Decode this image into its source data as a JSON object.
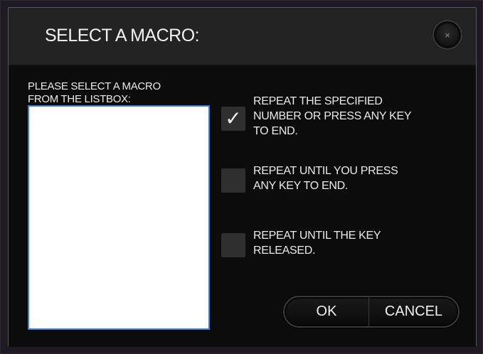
{
  "dialog": {
    "title": "SELECT A MACRO:",
    "close_symbol": "×"
  },
  "prompt": {
    "line1": "PLEASE SELECT A MACRO",
    "line2": "FROM THE LISTBOX:"
  },
  "listbox": {
    "items": []
  },
  "options": [
    {
      "lines": [
        "REPEAT THE SPECIFIED",
        "NUMBER OR PRESS ANY KEY",
        "TO END."
      ],
      "checked": true,
      "check_glyph": "✓"
    },
    {
      "lines": [
        "REPEAT UNTIL YOU PRESS",
        "ANY KEY TO END."
      ],
      "checked": false
    },
    {
      "lines": [
        "REPEAT UNTIL THE KEY",
        "RELEASED."
      ],
      "checked": false
    }
  ],
  "buttons": {
    "ok": "OK",
    "cancel": "CANCEL"
  }
}
